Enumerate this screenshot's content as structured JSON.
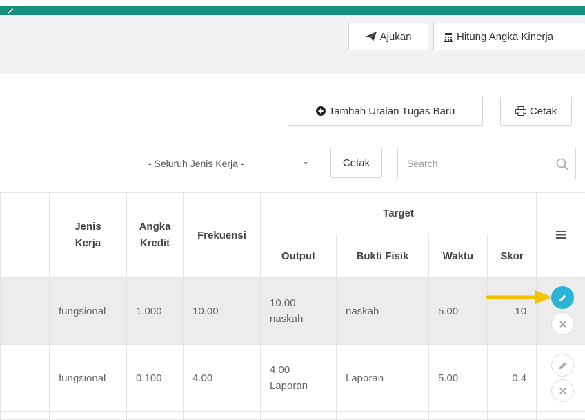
{
  "header": {
    "ajukan_label": "Ajukan",
    "hitung_label": "Hitung Angka Kinerja"
  },
  "toolbar": {
    "tambah_label": "Tambah Uraian Tugas Baru",
    "cetak_label": "Cetak"
  },
  "filter": {
    "jenis_kerja_selected": "- Seluruh Jenis Kerja -",
    "cetak_label": "Cetak",
    "search_placeholder": "Search"
  },
  "table": {
    "headers": {
      "jenis_kerja": "Jenis Kerja",
      "angka_kredit": "Angka Kredit",
      "frekuensi": "Frekuensi",
      "target": "Target",
      "output": "Output",
      "bukti_fisik": "Bukti Fisik",
      "waktu": "Waktu",
      "skor": "Skor"
    },
    "rows": [
      {
        "jenis_kerja": "fungsional",
        "angka_kredit": "1.000",
        "frekuensi": "10.00",
        "output_num": "10.00",
        "output_unit": "naskah",
        "bukti_fisik": "naskah",
        "waktu": "5.00",
        "skor": "10"
      },
      {
        "jenis_kerja": "fungsional",
        "angka_kredit": "0.100",
        "frekuensi": "4.00",
        "output_num": "4.00",
        "output_unit": "Laporan",
        "bukti_fisik": "Laporan",
        "waktu": "5.00",
        "skor": "0.4"
      }
    ]
  },
  "colors": {
    "teal": "#16917e",
    "edit_active": "#2bb3d6",
    "annotation_arrow": "#f2c400"
  },
  "icons": {
    "ajukan": "paper-plane-icon",
    "hitung": "calculator-icon",
    "tambah": "plus-circle-icon",
    "cetak": "printer-icon",
    "search": "search-icon",
    "menu": "hamburger-icon",
    "edit": "pencil-icon",
    "delete": "close-icon"
  }
}
